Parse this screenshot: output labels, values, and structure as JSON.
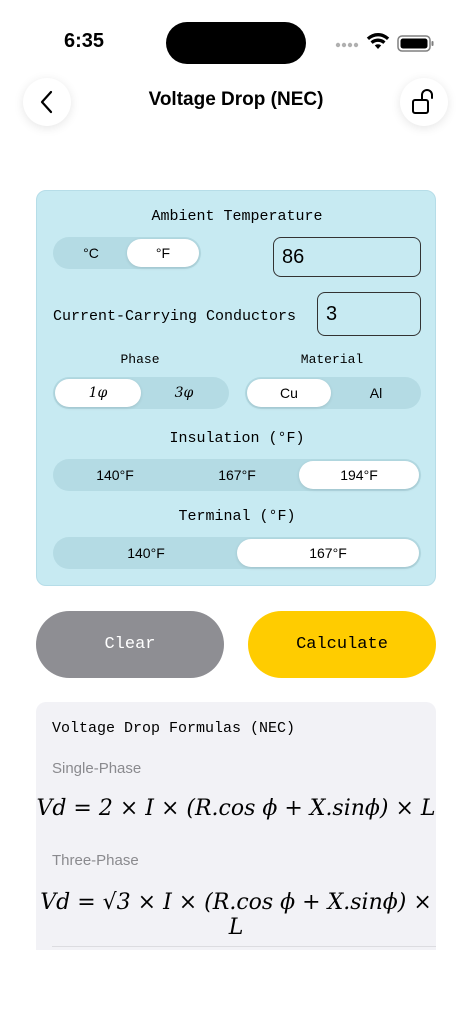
{
  "status_bar": {
    "time": "6:35"
  },
  "nav": {
    "title": "Voltage Drop (NEC)",
    "back_icon": "chevron-left-icon",
    "lock_icon": "unlock-icon"
  },
  "card": {
    "ambient_label": "Ambient Temperature",
    "unit_options": [
      "°C",
      "°F"
    ],
    "unit_selected": "°F",
    "ambient_value": "86",
    "ccc_label": "Current-Carrying Conductors",
    "ccc_value": "3",
    "phase_label": "Phase",
    "phase_options": [
      "1φ",
      "3φ"
    ],
    "phase_selected": "1φ",
    "material_label": "Material",
    "material_options": [
      "Cu",
      "Al"
    ],
    "material_selected": "Cu",
    "insulation_label": "Insulation (°F)",
    "insulation_options": [
      "140°F",
      "167°F",
      "194°F"
    ],
    "insulation_selected": "194°F",
    "terminal_label": "Terminal (°F)",
    "terminal_options": [
      "140°F",
      "167°F"
    ],
    "terminal_selected": "167°F"
  },
  "buttons": {
    "clear": "Clear",
    "calculate": "Calculate",
    "clear_color": "#8e8e93",
    "calculate_color": "#ffcc00"
  },
  "formulas": {
    "title": "Voltage Drop Formulas (NEC)",
    "single_label": "Single-Phase",
    "single_formula": "Vd = 2 × I × (R.cos ϕ  +  X.sinϕ) × L",
    "three_label": "Three-Phase",
    "three_formula": "Vd = √3 × I × (R.cos ϕ  +  X.sinϕ) × L"
  }
}
